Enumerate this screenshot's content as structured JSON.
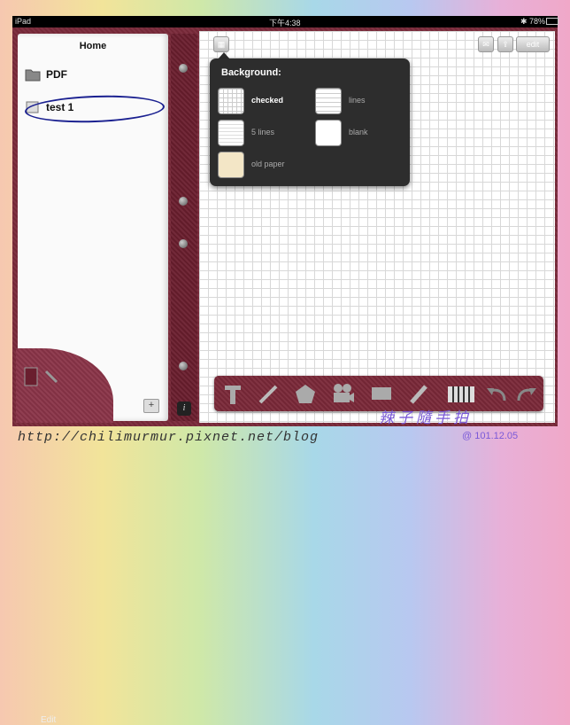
{
  "status_bar": {
    "device": "iPad",
    "time": "下午4:38",
    "battery": "78%"
  },
  "left_panel": {
    "title": "Home",
    "items": [
      {
        "label": "PDF",
        "icon": "folder-icon"
      },
      {
        "label": "test 1",
        "icon": "notebook-icon"
      }
    ],
    "edit_label": "Edit",
    "add_label": "+"
  },
  "spine": {
    "info_label": "i"
  },
  "top_toolbar": {
    "edit_label": "edit"
  },
  "popover": {
    "title": "Background:",
    "options": [
      {
        "label": "checked",
        "selected": true,
        "pattern": "grid"
      },
      {
        "label": "lines",
        "selected": false,
        "pattern": "lines"
      },
      {
        "label": "5 lines",
        "selected": false,
        "pattern": "five-lines"
      },
      {
        "label": "blank",
        "selected": false,
        "pattern": "blank"
      },
      {
        "label": "old paper",
        "selected": false,
        "pattern": "old-paper"
      }
    ]
  },
  "bottom_toolbar": {
    "tools": [
      "text-tool-icon",
      "pencil-icon",
      "pentagon-icon",
      "video-camera-icon",
      "rectangle-icon",
      "pen-icon",
      "piano-keys-icon",
      "undo-icon",
      "redo-icon"
    ]
  },
  "watermark": {
    "blog": "http://chilimurmur.pixnet.net/blog",
    "signature": "辣子隨手拍",
    "date": "@ 101.12.05"
  },
  "colors": {
    "leather": "#7a2a3a",
    "popover": "#2d2d2d",
    "selection_oval": "#1a2090"
  }
}
